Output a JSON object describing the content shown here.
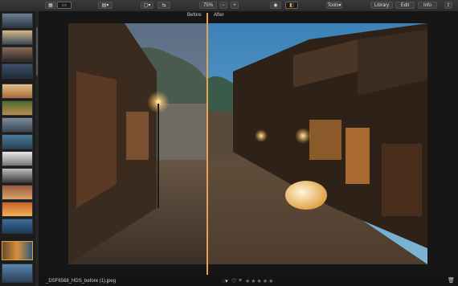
{
  "toolbar": {
    "zoom_value": "75%",
    "zoom_minus": "−",
    "zoom_plus": "+",
    "tools_label": "Tools",
    "library_label": "Library",
    "edit_label": "Edit",
    "info_label": "Info"
  },
  "compare": {
    "before_label": "Before",
    "after_label": "After"
  },
  "status": {
    "filename": "_DSF6568_HDS_before (1).jpeg",
    "rating_stars": "★★★★★"
  },
  "colors": {
    "accent": "#e4a44f",
    "toolbar_bg": "#2e2e2e",
    "canvas_bg": "#161616"
  },
  "icons": [
    "grid-view-icon",
    "single-view-icon",
    "dropdown-icon",
    "crop-icon",
    "compare-icon",
    "eye-icon",
    "split-view-icon",
    "share-icon",
    "trash-icon",
    "heart-icon",
    "circle-flag-icon"
  ]
}
